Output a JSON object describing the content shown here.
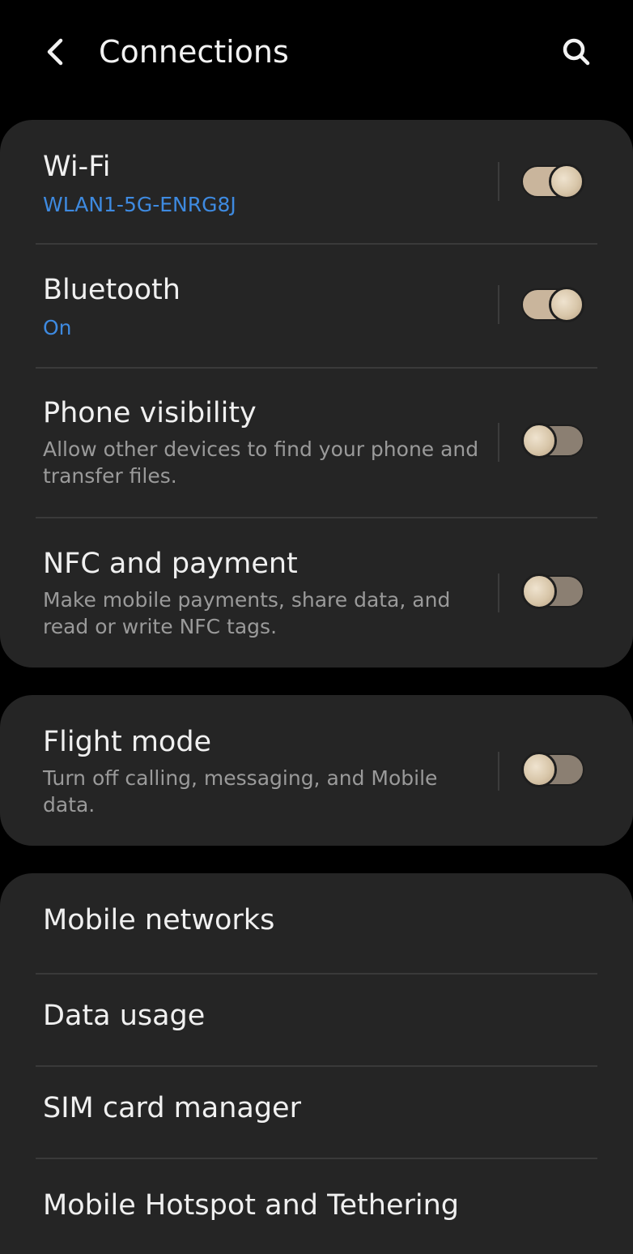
{
  "header": {
    "title": "Connections",
    "back_icon": "back-arrow-icon",
    "search_icon": "search-icon"
  },
  "connections": {
    "wifi": {
      "title": "Wi-Fi",
      "subtitle": "WLAN1-5G-ENRG8J",
      "enabled": true
    },
    "bluetooth": {
      "title": "Bluetooth",
      "subtitle": "On",
      "enabled": true
    },
    "phone_visibility": {
      "title": "Phone visibility",
      "subtitle": "Allow other devices to find your phone and transfer files.",
      "enabled": false
    },
    "nfc": {
      "title": "NFC and payment",
      "subtitle": "Make mobile payments, share data, and read or write NFC tags.",
      "enabled": false
    }
  },
  "flight": {
    "title": "Flight mode",
    "subtitle": "Turn off calling, messaging, and Mobile data.",
    "enabled": false
  },
  "more": {
    "mobile_networks": "Mobile networks",
    "data_usage": "Data usage",
    "sim_manager": "SIM card manager",
    "hotspot": "Mobile Hotspot and Tethering"
  },
  "colors": {
    "background": "#000000",
    "card": "#252525",
    "accent": "#3e8ae0",
    "secondary_text": "#9a9a9a",
    "toggle_on": "#c9b59c",
    "toggle_off": "#8b7f72"
  }
}
